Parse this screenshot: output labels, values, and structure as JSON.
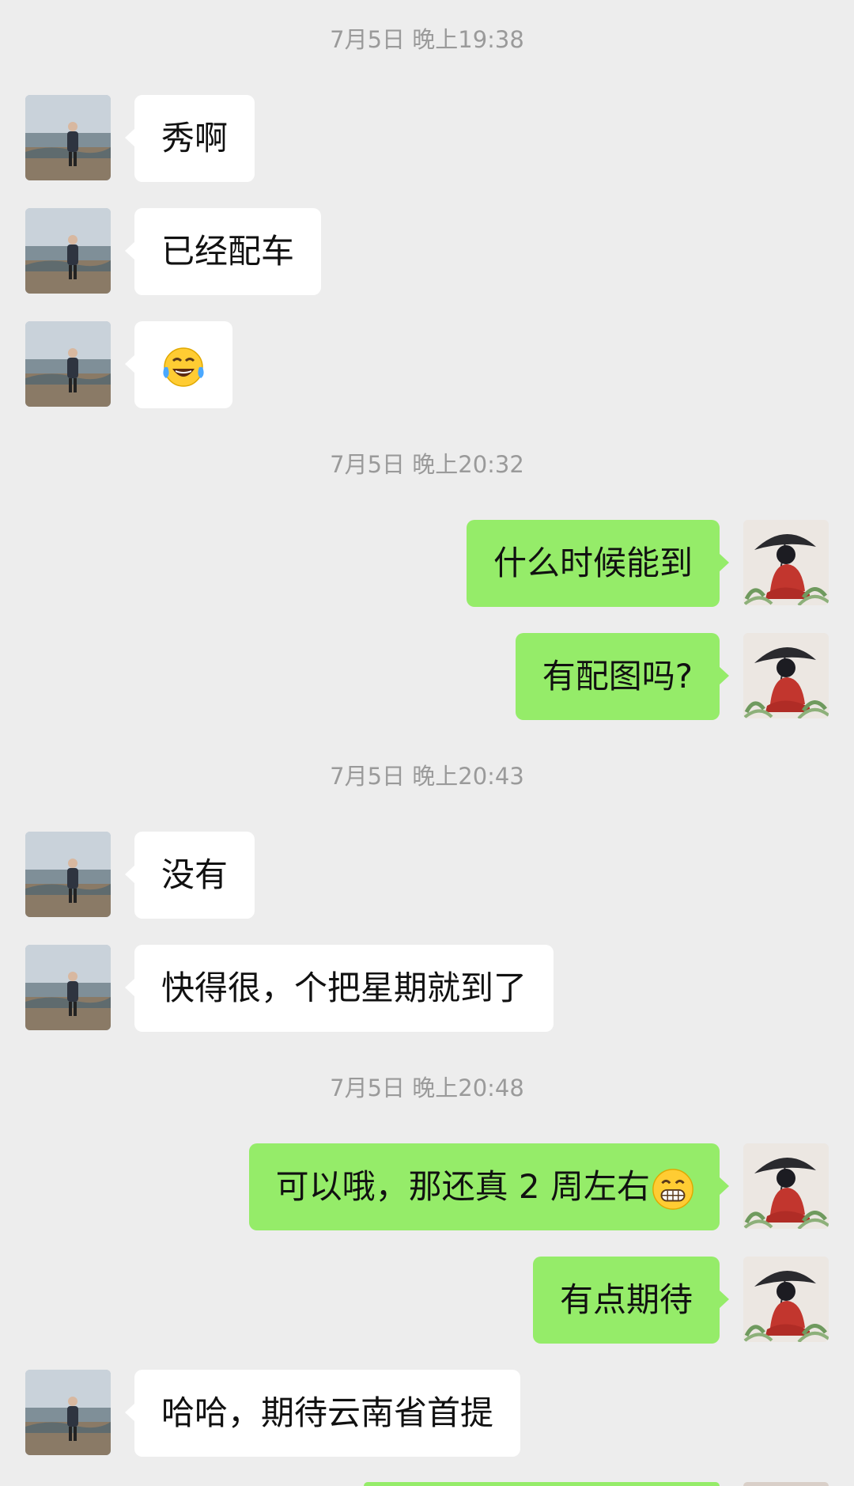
{
  "colors": {
    "background": "#ededed",
    "incoming_bubble": "#ffffff",
    "outgoing_bubble": "#95ec69",
    "timestamp_text": "#9a9a9a"
  },
  "timestamps": [
    "7月5日 晚上19:38",
    "7月5日 晚上20:32",
    "7月5日 晚上20:43",
    "7月5日 晚上20:48"
  ],
  "messages": [
    {
      "side": "incoming",
      "text": "秀啊"
    },
    {
      "side": "incoming",
      "text": "已经配车"
    },
    {
      "side": "incoming",
      "emoji": "tears-of-joy-emoji"
    },
    {
      "side": "outgoing",
      "text": "什么时候能到"
    },
    {
      "side": "outgoing",
      "text": "有配图吗?"
    },
    {
      "side": "incoming",
      "text": "没有"
    },
    {
      "side": "incoming",
      "text": "快得很，个把星期就到了"
    },
    {
      "side": "outgoing",
      "text": "可以哦，那还真 2 周左右",
      "emoji": "grinning-face-emoji"
    },
    {
      "side": "outgoing",
      "text": "有点期待"
    },
    {
      "side": "incoming",
      "text": "哈哈，期待云南省首提"
    }
  ],
  "avatars": {
    "incoming": "contact-avatar-beach-photo",
    "outgoing": "self-avatar-red-figure-umbrella"
  }
}
